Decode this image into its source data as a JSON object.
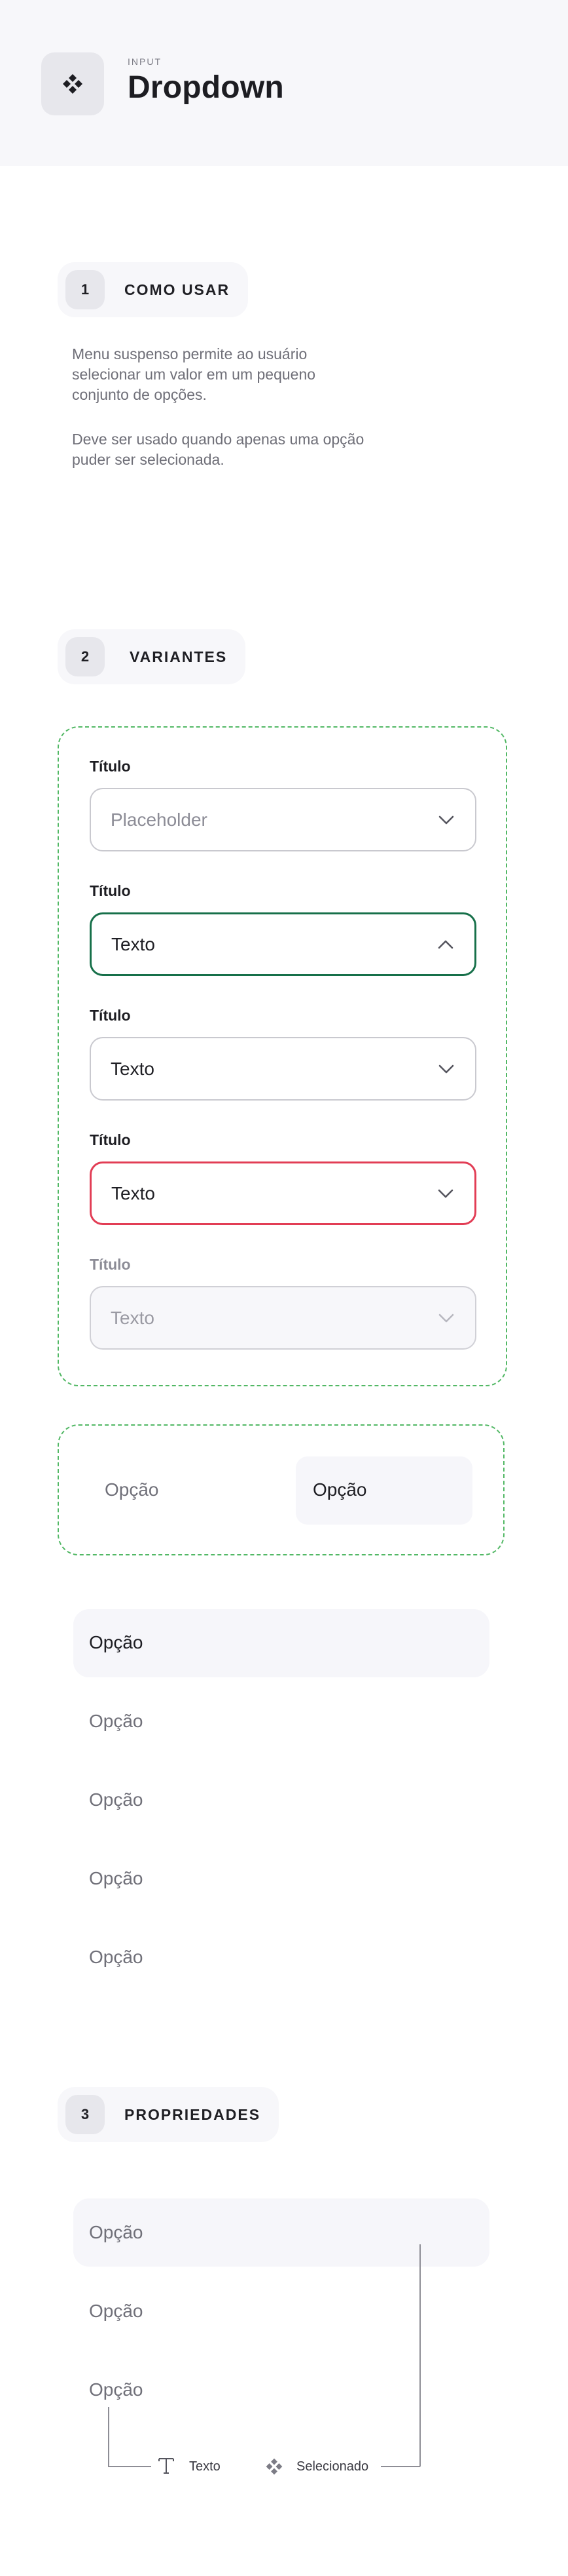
{
  "header": {
    "overline": "INPUT",
    "title": "Dropdown",
    "icon": "component-diamond-icon"
  },
  "sections": {
    "usage": {
      "number": "1",
      "label": "COMO USAR",
      "paragraphs": [
        "Menu suspenso permite ao usuário selecionar um valor em um pequeno conjunto de opções.",
        "Deve ser usado quando apenas uma opção puder ser selecionada."
      ]
    },
    "variants": {
      "number": "2",
      "label": "VARIANTES",
      "fields": [
        {
          "state": "placeholder",
          "label": "Título",
          "value": "Placeholder",
          "chevron": "chevron-down-icon"
        },
        {
          "state": "open",
          "label": "Título",
          "value": "Texto",
          "chevron": "chevron-up-icon"
        },
        {
          "state": "default",
          "label": "Título",
          "value": "Texto",
          "chevron": "chevron-down-icon"
        },
        {
          "state": "error",
          "label": "Título",
          "value": "Texto",
          "chevron": "chevron-down-icon"
        },
        {
          "state": "disabled",
          "label": "Título",
          "value": "Texto",
          "chevron": "chevron-down-icon"
        }
      ],
      "option_states": [
        {
          "state": "default",
          "label": "Opção"
        },
        {
          "state": "selected",
          "label": "Opção"
        }
      ],
      "menu_items": [
        "Opção",
        "Opção",
        "Opção",
        "Opção",
        "Opção"
      ]
    },
    "properties": {
      "number": "3",
      "label": "PROPRIEDADES",
      "items": [
        "Opção",
        "Opção",
        "Opção"
      ],
      "annotations": {
        "text": {
          "label": "Texto",
          "icon": "text-t-icon"
        },
        "selected": {
          "label": "Selecionado",
          "icon": "component-diamond-icon"
        }
      }
    }
  },
  "colors": {
    "focus_border": "#17704a",
    "error_border": "#e23d55",
    "dashed_border": "#52b865",
    "surface": "#f7f7fa"
  }
}
